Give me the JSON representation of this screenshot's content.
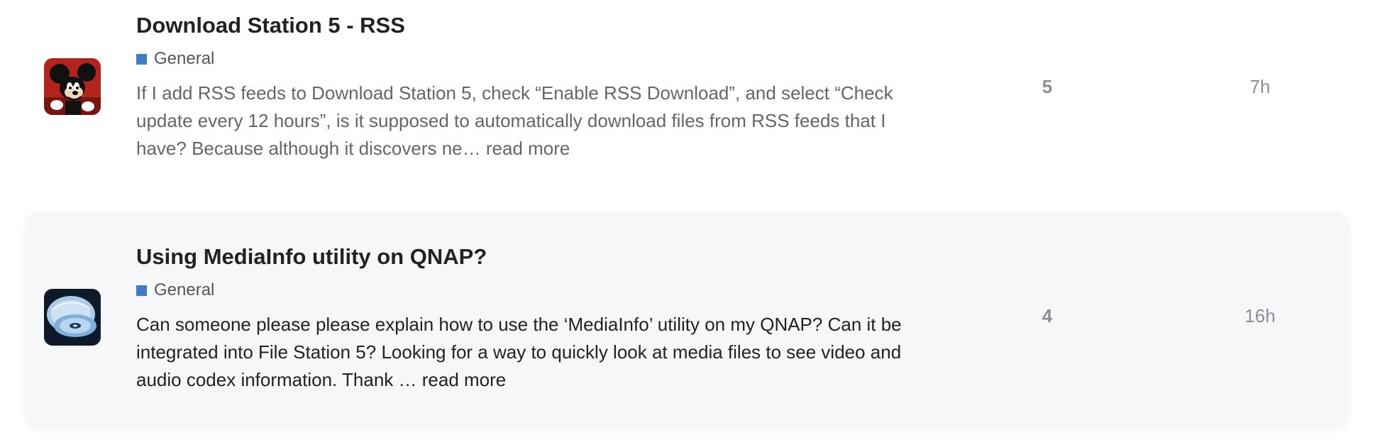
{
  "topics": [
    {
      "title": "Download Station 5 - RSS",
      "category": "General",
      "category_color": "#3d7dc6",
      "excerpt": "If I add RSS feeds to Download Station 5, check “Enable RSS Download”, and select “Check update every 12 hours”, is it supposed to automatically download files from RSS feeds that I have? Because although it discovers ne…",
      "read_more": "read more",
      "replies": "5",
      "activity": "7h",
      "avatar_icon": "cartoon-mouse-avatar-icon"
    },
    {
      "title": "Using MediaInfo utility on QNAP?",
      "category": "General",
      "category_color": "#3d7dc6",
      "excerpt": "Can someone please please explain how to use the ‘MediaInfo’ utility on my QNAP? Can it be integrated into File Station 5? Looking for a way to quickly look at media files to see video and audio codex information. Thank …",
      "read_more": "read more",
      "replies": "4",
      "activity": "16h",
      "avatar_icon": "disc-avatar-icon"
    }
  ]
}
